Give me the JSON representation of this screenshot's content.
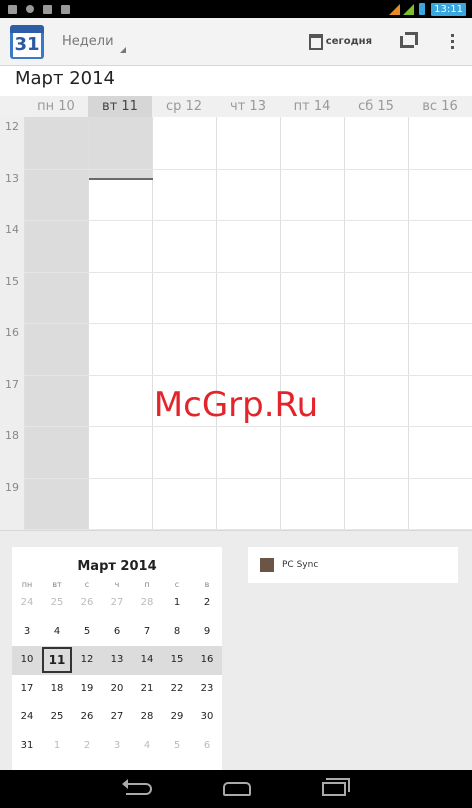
{
  "status_bar": {
    "clock": "13:11"
  },
  "action_bar": {
    "app_icon_day": "31",
    "view_selector": "Недели",
    "today_label": "сегодня"
  },
  "month_title": "Март 2014",
  "day_headers": [
    "пн 10",
    "вт 11",
    "ср 12",
    "чт 13",
    "пт 14",
    "сб 15",
    "вс 16"
  ],
  "hours": [
    "12",
    "13",
    "14",
    "15",
    "16",
    "17",
    "18",
    "19"
  ],
  "mini_calendar": {
    "title": "Март 2014",
    "weekdays": [
      "пн",
      "вт",
      "с",
      "ч",
      "п",
      "с",
      "в"
    ],
    "weeks": [
      [
        {
          "d": "24",
          "o": true
        },
        {
          "d": "25",
          "o": true
        },
        {
          "d": "26",
          "o": true
        },
        {
          "d": "27",
          "o": true
        },
        {
          "d": "28",
          "o": true
        },
        {
          "d": "1"
        },
        {
          "d": "2"
        }
      ],
      [
        {
          "d": "3"
        },
        {
          "d": "4"
        },
        {
          "d": "5"
        },
        {
          "d": "6"
        },
        {
          "d": "7"
        },
        {
          "d": "8"
        },
        {
          "d": "9"
        }
      ],
      [
        {
          "d": "10"
        },
        {
          "d": "11",
          "today": true
        },
        {
          "d": "12"
        },
        {
          "d": "13"
        },
        {
          "d": "14"
        },
        {
          "d": "15"
        },
        {
          "d": "16"
        }
      ],
      [
        {
          "d": "17"
        },
        {
          "d": "18"
        },
        {
          "d": "19"
        },
        {
          "d": "20"
        },
        {
          "d": "21"
        },
        {
          "d": "22"
        },
        {
          "d": "23"
        }
      ],
      [
        {
          "d": "24"
        },
        {
          "d": "25"
        },
        {
          "d": "26"
        },
        {
          "d": "27"
        },
        {
          "d": "28"
        },
        {
          "d": "29"
        },
        {
          "d": "30"
        }
      ],
      [
        {
          "d": "31"
        },
        {
          "d": "1",
          "o": true
        },
        {
          "d": "2",
          "o": true
        },
        {
          "d": "3",
          "o": true
        },
        {
          "d": "4",
          "o": true
        },
        {
          "d": "5",
          "o": true
        },
        {
          "d": "6",
          "o": true
        }
      ]
    ]
  },
  "calendars": [
    {
      "name": "PC Sync",
      "color": "#6b5546"
    }
  ],
  "watermark": "McGrp.Ru",
  "colors": {
    "status_accent": "#3aa6de",
    "today_border": "#333333"
  }
}
